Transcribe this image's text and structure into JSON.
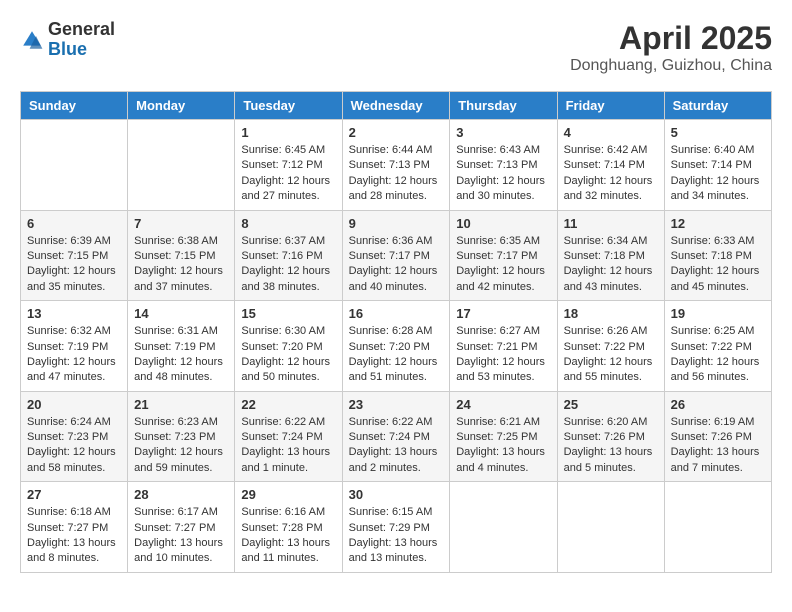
{
  "header": {
    "logo_general": "General",
    "logo_blue": "Blue",
    "month": "April 2025",
    "location": "Donghuang, Guizhou, China"
  },
  "days_of_week": [
    "Sunday",
    "Monday",
    "Tuesday",
    "Wednesday",
    "Thursday",
    "Friday",
    "Saturday"
  ],
  "weeks": [
    [
      null,
      null,
      {
        "day": "1",
        "sunrise": "Sunrise: 6:45 AM",
        "sunset": "Sunset: 7:12 PM",
        "daylight": "Daylight: 12 hours and 27 minutes."
      },
      {
        "day": "2",
        "sunrise": "Sunrise: 6:44 AM",
        "sunset": "Sunset: 7:13 PM",
        "daylight": "Daylight: 12 hours and 28 minutes."
      },
      {
        "day": "3",
        "sunrise": "Sunrise: 6:43 AM",
        "sunset": "Sunset: 7:13 PM",
        "daylight": "Daylight: 12 hours and 30 minutes."
      },
      {
        "day": "4",
        "sunrise": "Sunrise: 6:42 AM",
        "sunset": "Sunset: 7:14 PM",
        "daylight": "Daylight: 12 hours and 32 minutes."
      },
      {
        "day": "5",
        "sunrise": "Sunrise: 6:40 AM",
        "sunset": "Sunset: 7:14 PM",
        "daylight": "Daylight: 12 hours and 34 minutes."
      }
    ],
    [
      {
        "day": "6",
        "sunrise": "Sunrise: 6:39 AM",
        "sunset": "Sunset: 7:15 PM",
        "daylight": "Daylight: 12 hours and 35 minutes."
      },
      {
        "day": "7",
        "sunrise": "Sunrise: 6:38 AM",
        "sunset": "Sunset: 7:15 PM",
        "daylight": "Daylight: 12 hours and 37 minutes."
      },
      {
        "day": "8",
        "sunrise": "Sunrise: 6:37 AM",
        "sunset": "Sunset: 7:16 PM",
        "daylight": "Daylight: 12 hours and 38 minutes."
      },
      {
        "day": "9",
        "sunrise": "Sunrise: 6:36 AM",
        "sunset": "Sunset: 7:17 PM",
        "daylight": "Daylight: 12 hours and 40 minutes."
      },
      {
        "day": "10",
        "sunrise": "Sunrise: 6:35 AM",
        "sunset": "Sunset: 7:17 PM",
        "daylight": "Daylight: 12 hours and 42 minutes."
      },
      {
        "day": "11",
        "sunrise": "Sunrise: 6:34 AM",
        "sunset": "Sunset: 7:18 PM",
        "daylight": "Daylight: 12 hours and 43 minutes."
      },
      {
        "day": "12",
        "sunrise": "Sunrise: 6:33 AM",
        "sunset": "Sunset: 7:18 PM",
        "daylight": "Daylight: 12 hours and 45 minutes."
      }
    ],
    [
      {
        "day": "13",
        "sunrise": "Sunrise: 6:32 AM",
        "sunset": "Sunset: 7:19 PM",
        "daylight": "Daylight: 12 hours and 47 minutes."
      },
      {
        "day": "14",
        "sunrise": "Sunrise: 6:31 AM",
        "sunset": "Sunset: 7:19 PM",
        "daylight": "Daylight: 12 hours and 48 minutes."
      },
      {
        "day": "15",
        "sunrise": "Sunrise: 6:30 AM",
        "sunset": "Sunset: 7:20 PM",
        "daylight": "Daylight: 12 hours and 50 minutes."
      },
      {
        "day": "16",
        "sunrise": "Sunrise: 6:28 AM",
        "sunset": "Sunset: 7:20 PM",
        "daylight": "Daylight: 12 hours and 51 minutes."
      },
      {
        "day": "17",
        "sunrise": "Sunrise: 6:27 AM",
        "sunset": "Sunset: 7:21 PM",
        "daylight": "Daylight: 12 hours and 53 minutes."
      },
      {
        "day": "18",
        "sunrise": "Sunrise: 6:26 AM",
        "sunset": "Sunset: 7:22 PM",
        "daylight": "Daylight: 12 hours and 55 minutes."
      },
      {
        "day": "19",
        "sunrise": "Sunrise: 6:25 AM",
        "sunset": "Sunset: 7:22 PM",
        "daylight": "Daylight: 12 hours and 56 minutes."
      }
    ],
    [
      {
        "day": "20",
        "sunrise": "Sunrise: 6:24 AM",
        "sunset": "Sunset: 7:23 PM",
        "daylight": "Daylight: 12 hours and 58 minutes."
      },
      {
        "day": "21",
        "sunrise": "Sunrise: 6:23 AM",
        "sunset": "Sunset: 7:23 PM",
        "daylight": "Daylight: 12 hours and 59 minutes."
      },
      {
        "day": "22",
        "sunrise": "Sunrise: 6:22 AM",
        "sunset": "Sunset: 7:24 PM",
        "daylight": "Daylight: 13 hours and 1 minute."
      },
      {
        "day": "23",
        "sunrise": "Sunrise: 6:22 AM",
        "sunset": "Sunset: 7:24 PM",
        "daylight": "Daylight: 13 hours and 2 minutes."
      },
      {
        "day": "24",
        "sunrise": "Sunrise: 6:21 AM",
        "sunset": "Sunset: 7:25 PM",
        "daylight": "Daylight: 13 hours and 4 minutes."
      },
      {
        "day": "25",
        "sunrise": "Sunrise: 6:20 AM",
        "sunset": "Sunset: 7:26 PM",
        "daylight": "Daylight: 13 hours and 5 minutes."
      },
      {
        "day": "26",
        "sunrise": "Sunrise: 6:19 AM",
        "sunset": "Sunset: 7:26 PM",
        "daylight": "Daylight: 13 hours and 7 minutes."
      }
    ],
    [
      {
        "day": "27",
        "sunrise": "Sunrise: 6:18 AM",
        "sunset": "Sunset: 7:27 PM",
        "daylight": "Daylight: 13 hours and 8 minutes."
      },
      {
        "day": "28",
        "sunrise": "Sunrise: 6:17 AM",
        "sunset": "Sunset: 7:27 PM",
        "daylight": "Daylight: 13 hours and 10 minutes."
      },
      {
        "day": "29",
        "sunrise": "Sunrise: 6:16 AM",
        "sunset": "Sunset: 7:28 PM",
        "daylight": "Daylight: 13 hours and 11 minutes."
      },
      {
        "day": "30",
        "sunrise": "Sunrise: 6:15 AM",
        "sunset": "Sunset: 7:29 PM",
        "daylight": "Daylight: 13 hours and 13 minutes."
      },
      null,
      null,
      null
    ]
  ]
}
